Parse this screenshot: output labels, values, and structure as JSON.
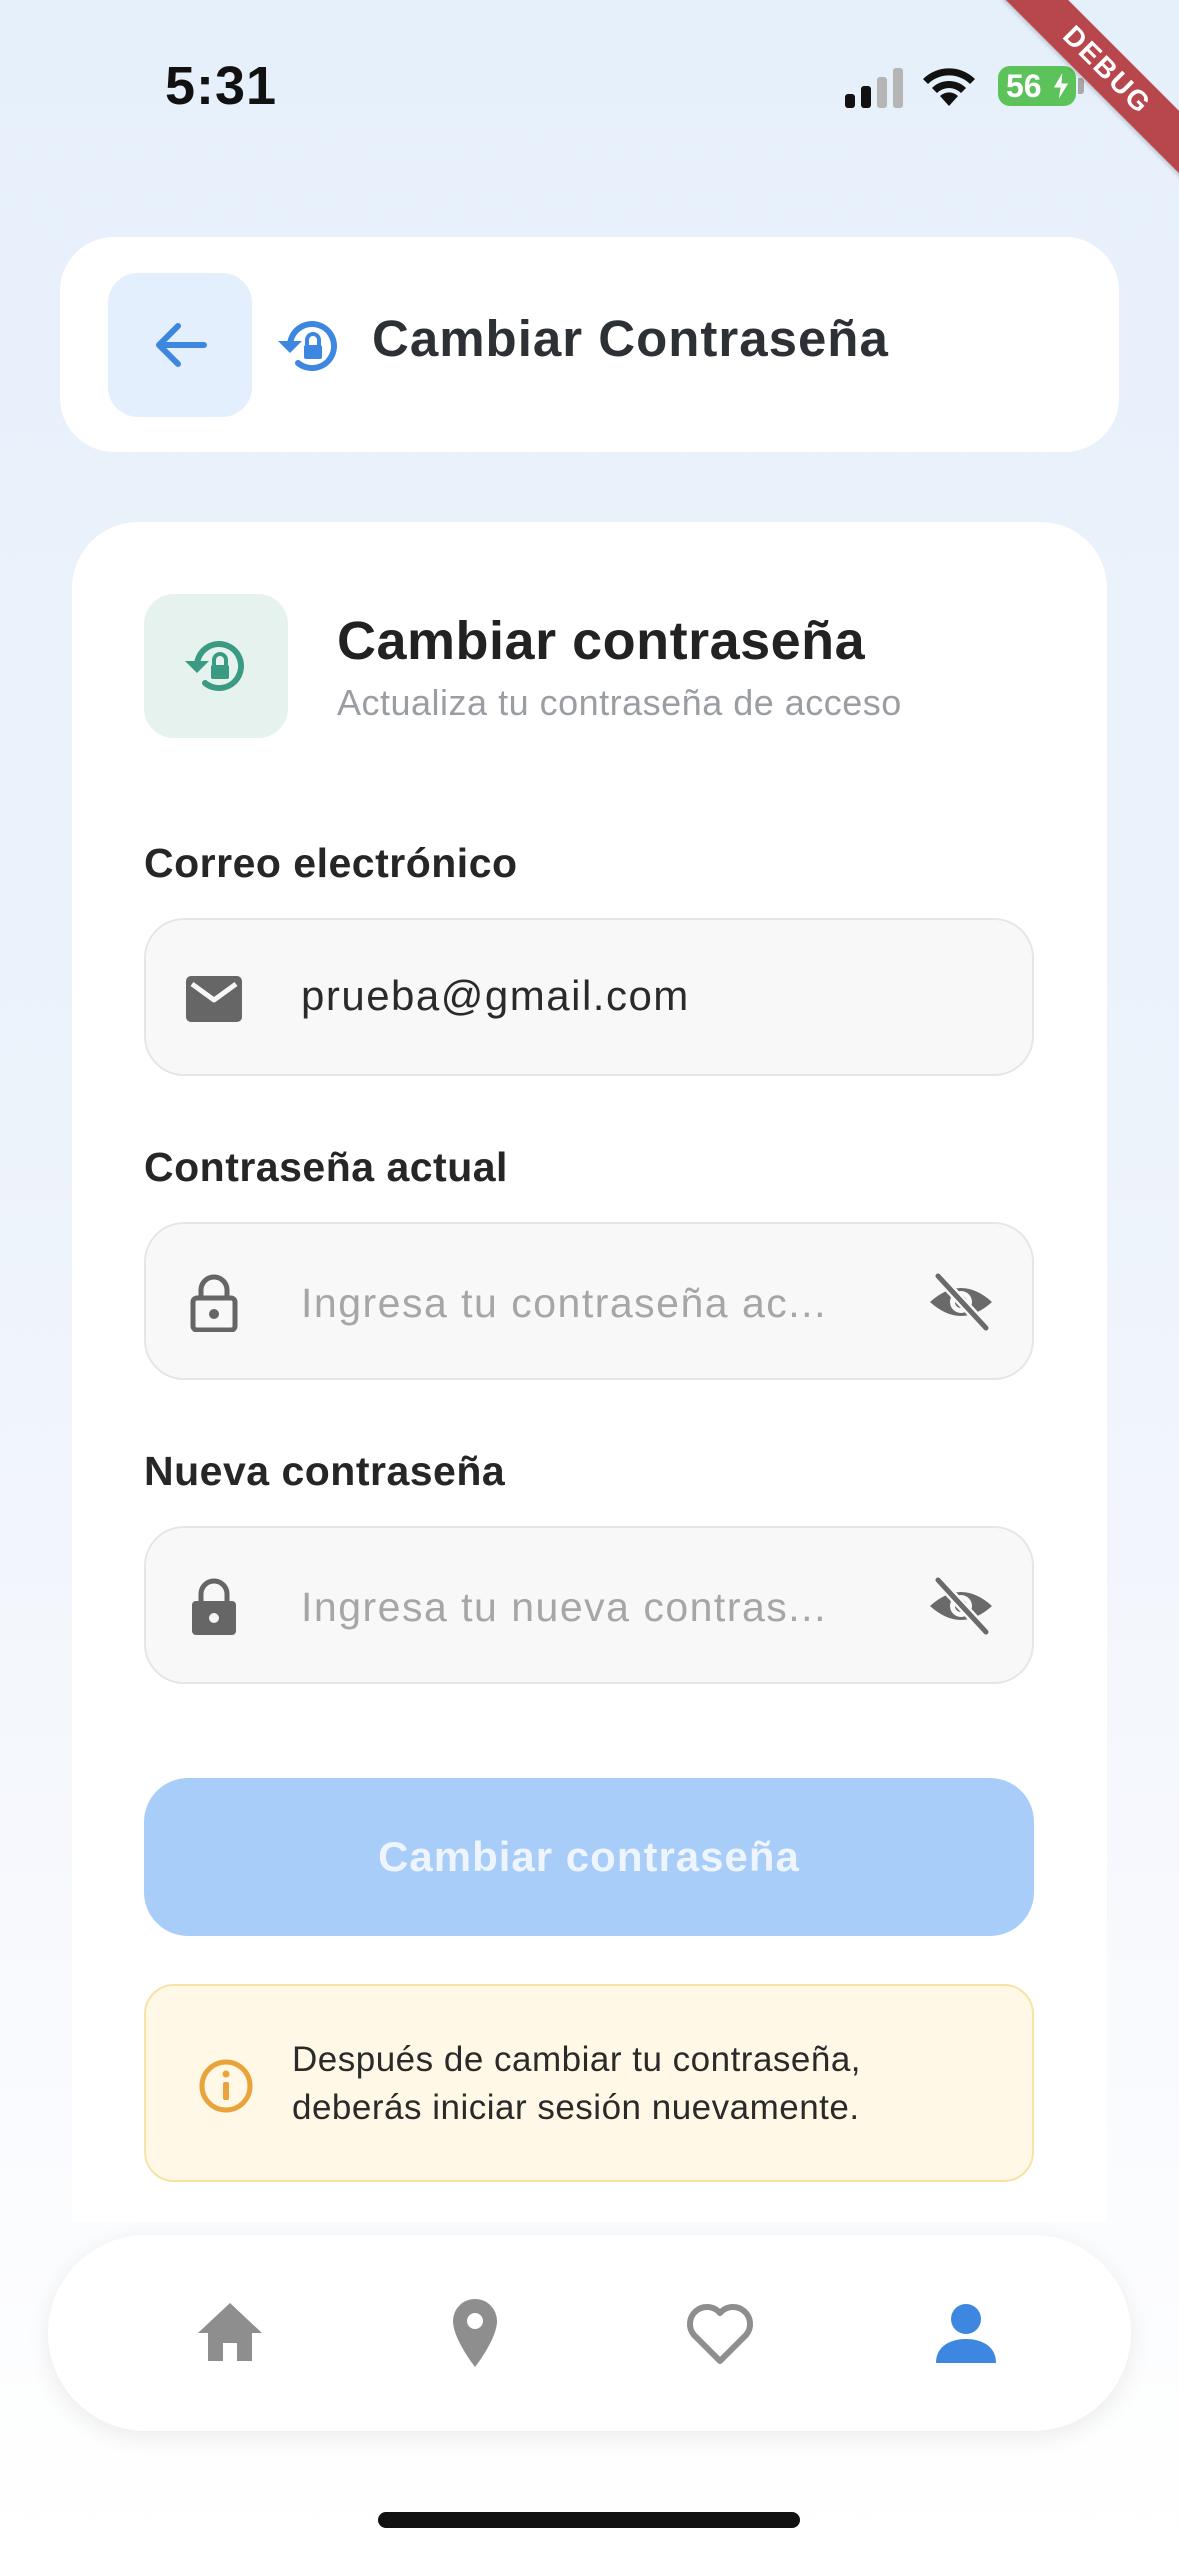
{
  "status_bar": {
    "time": "5:31",
    "battery": "56"
  },
  "debug_banner": "DEBUG",
  "header": {
    "title": "Cambiar Contraseña"
  },
  "card": {
    "title": "Cambiar contraseña",
    "subtitle": "Actualiza tu contraseña de acceso"
  },
  "form": {
    "email": {
      "label": "Correo electrónico",
      "value": "prueba@gmail.com"
    },
    "current_password": {
      "label": "Contraseña actual",
      "placeholder": "Ingresa tu contraseña ac..."
    },
    "new_password": {
      "label": "Nueva contraseña",
      "placeholder": "Ingresa tu nueva contras..."
    },
    "submit_label": "Cambiar contraseña"
  },
  "info": {
    "line1": "Después de cambiar tu contraseña,",
    "line2": "deberás iniciar sesión nuevamente."
  },
  "colors": {
    "accent": "#3d87e0",
    "teal": "#3a9a82",
    "button_disabled": "#a7cdf8",
    "info_bg": "#fff8e6",
    "info_icon": "#eaa23a",
    "nav_inactive": "#8e8e8e"
  },
  "icons": {
    "back": "arrow-left-icon",
    "header": "lock-reset-icon",
    "card": "lock-reset-icon",
    "email": "envelope-icon",
    "current_password": "lock-outline-icon",
    "new_password": "lock-icon",
    "visibility": "eye-off-icon",
    "info": "info-icon"
  },
  "bottom_nav": {
    "items": [
      "home-icon",
      "location-pin-icon",
      "heart-outline-icon",
      "person-icon"
    ],
    "active": "person-icon"
  }
}
